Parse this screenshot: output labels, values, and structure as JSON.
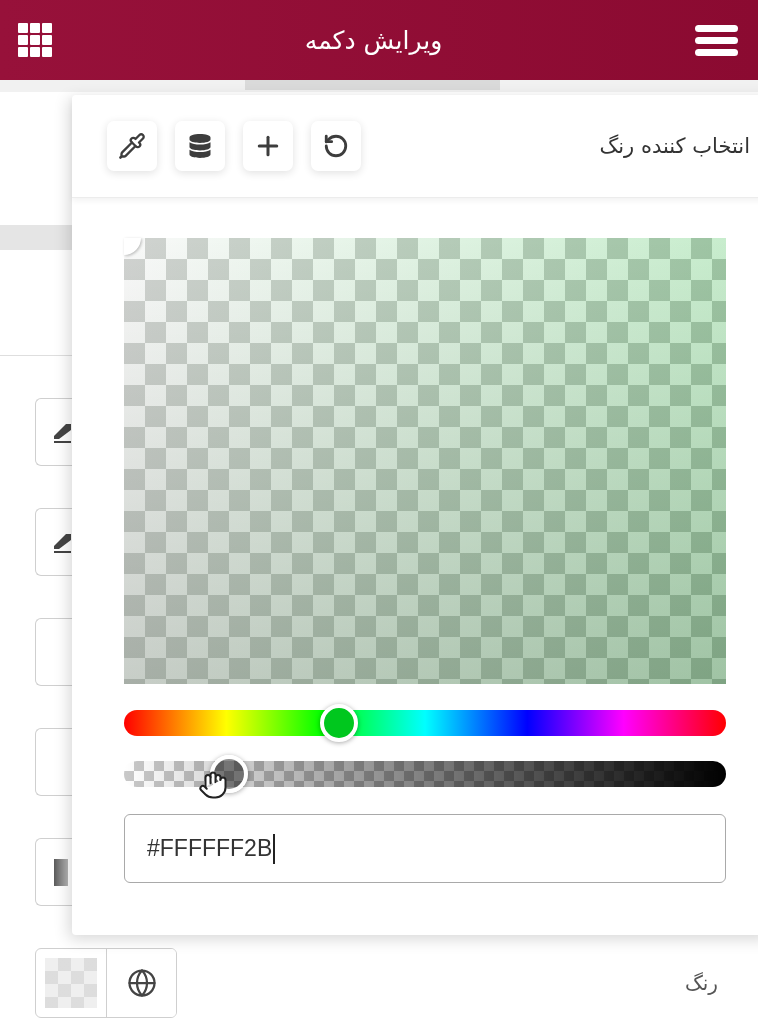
{
  "header": {
    "title": "ویرایش دکمه"
  },
  "color_picker": {
    "title": "انتخاب کننده رنگ",
    "hue_slider": {
      "level": 0.357
    },
    "alpha_slider": {
      "level": 0.174
    },
    "hex_input": {
      "value": "#FFFFFF2B"
    }
  },
  "color_field": {
    "label": "رنگ"
  }
}
